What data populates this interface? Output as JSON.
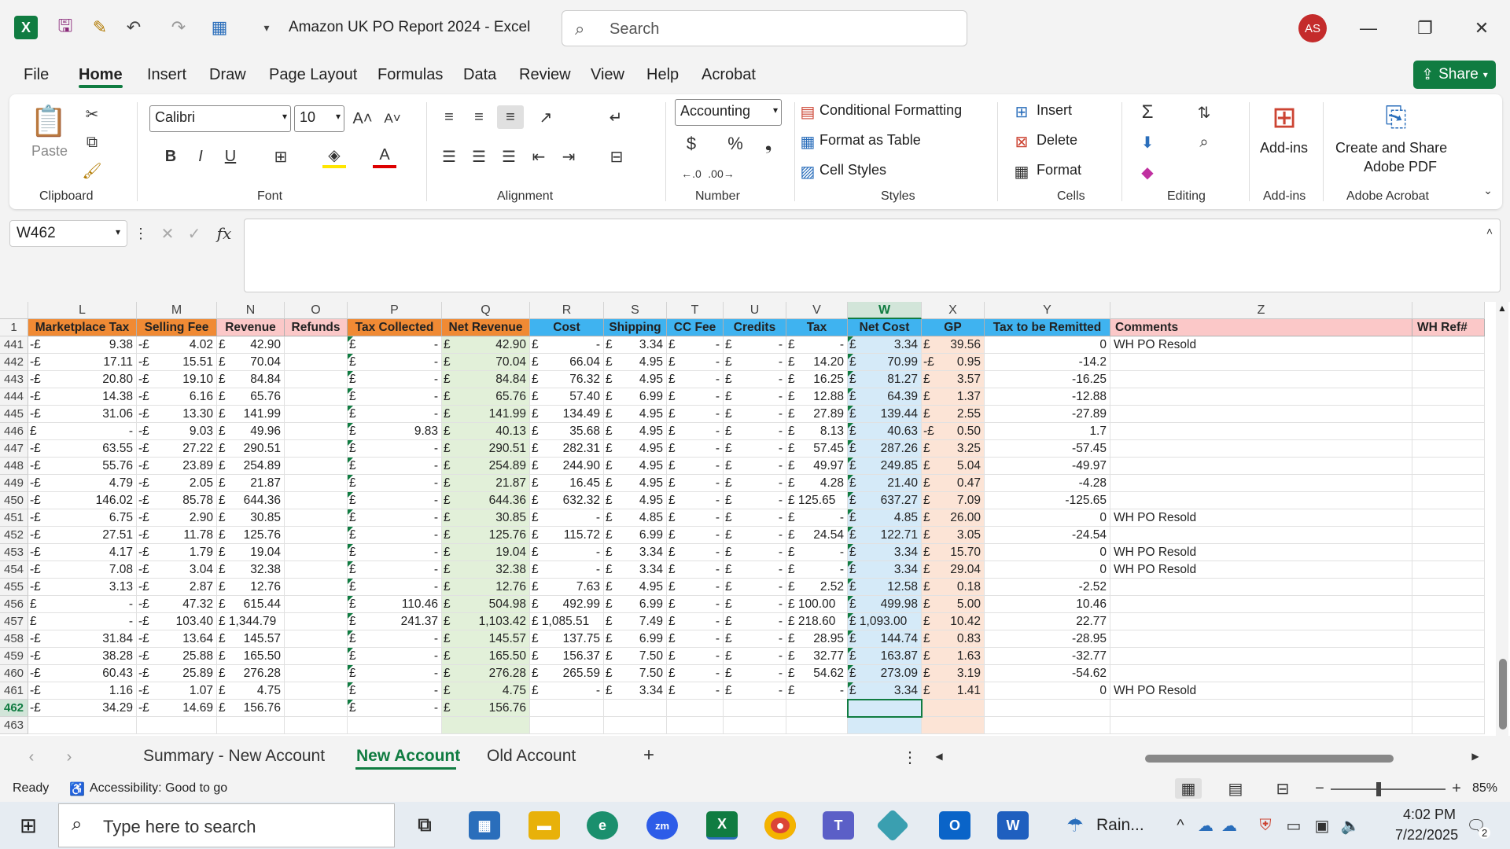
{
  "app": {
    "title": "Amazon UK PO Report 2024  -  Excel",
    "search_placeholder": "Search",
    "avatar": "AS"
  },
  "menu": [
    "File",
    "Home",
    "Insert",
    "Draw",
    "Page Layout",
    "Formulas",
    "Data",
    "Review",
    "View",
    "Help",
    "Acrobat"
  ],
  "share_label": "Share",
  "ribbon": {
    "clipboard": {
      "label": "Clipboard",
      "paste": "Paste"
    },
    "font": {
      "label": "Font",
      "name": "Calibri",
      "size": "10"
    },
    "alignment": {
      "label": "Alignment"
    },
    "number": {
      "label": "Number",
      "format": "Accounting"
    },
    "styles": {
      "label": "Styles",
      "cond": "Conditional Formatting",
      "table": "Format as Table",
      "cell": "Cell Styles"
    },
    "cells": {
      "label": "Cells",
      "insert": "Insert",
      "delete": "Delete",
      "format": "Format"
    },
    "editing": {
      "label": "Editing"
    },
    "addins": {
      "label": "Add-ins",
      "btn": "Add-ins"
    },
    "acrobat": {
      "label": "Adobe Acrobat",
      "btn1": "Create and Share",
      "btn2": "Adobe PDF"
    }
  },
  "namebox": "W462",
  "columns": [
    "L",
    "M",
    "N",
    "O",
    "P",
    "Q",
    "R",
    "S",
    "T",
    "U",
    "V",
    "W",
    "X",
    "Y",
    "Z"
  ],
  "headers": [
    "Marketplace Tax",
    "Selling Fee",
    "Revenue",
    "Refunds",
    "Tax Collected",
    "Net Revenue",
    "Cost",
    "Shipping",
    "CC Fee",
    "Credits",
    "Tax",
    "Net Cost",
    "GP",
    "Tax to be Remitted",
    "Comments",
    "WH Ref#"
  ],
  "rows": [
    [
      "441",
      "-£",
      "9.38",
      "-£",
      "4.02",
      "£",
      "42.90",
      "",
      "£",
      "-",
      "£",
      "42.90",
      "£",
      "-",
      "£",
      "3.34",
      "£",
      "-",
      "£",
      "-",
      "£",
      "-",
      "£",
      "3.34",
      "£",
      "39.56",
      "0",
      "WH PO Resold"
    ],
    [
      "442",
      "-£",
      "17.11",
      "-£",
      "15.51",
      "£",
      "70.04",
      "",
      "£",
      "-",
      "£",
      "70.04",
      "£",
      "66.04",
      "£",
      "4.95",
      "£",
      "-",
      "£",
      "-",
      "£",
      "14.20",
      "£",
      "70.99",
      "-£",
      "0.95",
      "-14.2",
      ""
    ],
    [
      "443",
      "-£",
      "20.80",
      "-£",
      "19.10",
      "£",
      "84.84",
      "",
      "£",
      "-",
      "£",
      "84.84",
      "£",
      "76.32",
      "£",
      "4.95",
      "£",
      "-",
      "£",
      "-",
      "£",
      "16.25",
      "£",
      "81.27",
      "£",
      "3.57",
      "-16.25",
      ""
    ],
    [
      "444",
      "-£",
      "14.38",
      "-£",
      "6.16",
      "£",
      "65.76",
      "",
      "£",
      "-",
      "£",
      "65.76",
      "£",
      "57.40",
      "£",
      "6.99",
      "£",
      "-",
      "£",
      "-",
      "£",
      "12.88",
      "£",
      "64.39",
      "£",
      "1.37",
      "-12.88",
      ""
    ],
    [
      "445",
      "-£",
      "31.06",
      "-£",
      "13.30",
      "£",
      "141.99",
      "",
      "£",
      "-",
      "£",
      "141.99",
      "£",
      "134.49",
      "£",
      "4.95",
      "£",
      "-",
      "£",
      "-",
      "£",
      "27.89",
      "£",
      "139.44",
      "£",
      "2.55",
      "-27.89",
      ""
    ],
    [
      "446",
      "£",
      "-",
      "-£",
      "9.03",
      "£",
      "49.96",
      "",
      "£",
      "9.83",
      "£",
      "40.13",
      "£",
      "35.68",
      "£",
      "4.95",
      "£",
      "-",
      "£",
      "-",
      "£",
      "8.13",
      "£",
      "40.63",
      "-£",
      "0.50",
      "1.7",
      ""
    ],
    [
      "447",
      "-£",
      "63.55",
      "-£",
      "27.22",
      "£",
      "290.51",
      "",
      "£",
      "-",
      "£",
      "290.51",
      "£",
      "282.31",
      "£",
      "4.95",
      "£",
      "-",
      "£",
      "-",
      "£",
      "57.45",
      "£",
      "287.26",
      "£",
      "3.25",
      "-57.45",
      ""
    ],
    [
      "448",
      "-£",
      "55.76",
      "-£",
      "23.89",
      "£",
      "254.89",
      "",
      "£",
      "-",
      "£",
      "254.89",
      "£",
      "244.90",
      "£",
      "4.95",
      "£",
      "-",
      "£",
      "-",
      "£",
      "49.97",
      "£",
      "249.85",
      "£",
      "5.04",
      "-49.97",
      ""
    ],
    [
      "449",
      "-£",
      "4.79",
      "-£",
      "2.05",
      "£",
      "21.87",
      "",
      "£",
      "-",
      "£",
      "21.87",
      "£",
      "16.45",
      "£",
      "4.95",
      "£",
      "-",
      "£",
      "-",
      "£",
      "4.28",
      "£",
      "21.40",
      "£",
      "0.47",
      "-4.28",
      ""
    ],
    [
      "450",
      "-£",
      "146.02",
      "-£",
      "85.78",
      "£",
      "644.36",
      "",
      "£",
      "-",
      "£",
      "644.36",
      "£",
      "632.32",
      "£",
      "4.95",
      "£",
      "-",
      "£",
      "-",
      "£ 125.65",
      "",
      "£",
      "637.27",
      "£",
      "7.09",
      "-125.65",
      ""
    ],
    [
      "451",
      "-£",
      "6.75",
      "-£",
      "2.90",
      "£",
      "30.85",
      "",
      "£",
      "-",
      "£",
      "30.85",
      "£",
      "-",
      "£",
      "4.85",
      "£",
      "-",
      "£",
      "-",
      "£",
      "-",
      "£",
      "4.85",
      "£",
      "26.00",
      "0",
      "WH PO Resold"
    ],
    [
      "452",
      "-£",
      "27.51",
      "-£",
      "11.78",
      "£",
      "125.76",
      "",
      "£",
      "-",
      "£",
      "125.76",
      "£",
      "115.72",
      "£",
      "6.99",
      "£",
      "-",
      "£",
      "-",
      "£",
      "24.54",
      "£",
      "122.71",
      "£",
      "3.05",
      "-24.54",
      ""
    ],
    [
      "453",
      "-£",
      "4.17",
      "-£",
      "1.79",
      "£",
      "19.04",
      "",
      "£",
      "-",
      "£",
      "19.04",
      "£",
      "-",
      "£",
      "3.34",
      "£",
      "-",
      "£",
      "-",
      "£",
      "-",
      "£",
      "3.34",
      "£",
      "15.70",
      "0",
      "WH PO Resold"
    ],
    [
      "454",
      "-£",
      "7.08",
      "-£",
      "3.04",
      "£",
      "32.38",
      "",
      "£",
      "-",
      "£",
      "32.38",
      "£",
      "-",
      "£",
      "3.34",
      "£",
      "-",
      "£",
      "-",
      "£",
      "-",
      "£",
      "3.34",
      "£",
      "29.04",
      "0",
      "WH PO Resold"
    ],
    [
      "455",
      "-£",
      "3.13",
      "-£",
      "2.87",
      "£",
      "12.76",
      "",
      "£",
      "-",
      "£",
      "12.76",
      "£",
      "7.63",
      "£",
      "4.95",
      "£",
      "-",
      "£",
      "-",
      "£",
      "2.52",
      "£",
      "12.58",
      "£",
      "0.18",
      "-2.52",
      ""
    ],
    [
      "456",
      "£",
      "-",
      "-£",
      "47.32",
      "£",
      "615.44",
      "",
      "£",
      "110.46",
      "£",
      "504.98",
      "£",
      "492.99",
      "£",
      "6.99",
      "£",
      "-",
      "£",
      "-",
      "£ 100.00",
      "",
      "£",
      "499.98",
      "£",
      "5.00",
      "10.46",
      ""
    ],
    [
      "457",
      "£",
      "-",
      "-£",
      "103.40",
      "£ 1,344.79",
      "",
      "",
      "£",
      "241.37",
      "£",
      "1,103.42",
      "£ 1,085.51",
      "",
      "£",
      "7.49",
      "£",
      "-",
      "£",
      "-",
      "£ 218.60",
      "",
      "£ 1,093.00",
      "",
      "£",
      "10.42",
      "22.77",
      ""
    ],
    [
      "458",
      "-£",
      "31.84",
      "-£",
      "13.64",
      "£",
      "145.57",
      "",
      "£",
      "-",
      "£",
      "145.57",
      "£",
      "137.75",
      "£",
      "6.99",
      "£",
      "-",
      "£",
      "-",
      "£",
      "28.95",
      "£",
      "144.74",
      "£",
      "0.83",
      "-28.95",
      ""
    ],
    [
      "459",
      "-£",
      "38.28",
      "-£",
      "25.88",
      "£",
      "165.50",
      "",
      "£",
      "-",
      "£",
      "165.50",
      "£",
      "156.37",
      "£",
      "7.50",
      "£",
      "-",
      "£",
      "-",
      "£",
      "32.77",
      "£",
      "163.87",
      "£",
      "1.63",
      "-32.77",
      ""
    ],
    [
      "460",
      "-£",
      "60.43",
      "-£",
      "25.89",
      "£",
      "276.28",
      "",
      "£",
      "-",
      "£",
      "276.28",
      "£",
      "265.59",
      "£",
      "7.50",
      "£",
      "-",
      "£",
      "-",
      "£",
      "54.62",
      "£",
      "273.09",
      "£",
      "3.19",
      "-54.62",
      ""
    ],
    [
      "461",
      "-£",
      "1.16",
      "-£",
      "1.07",
      "£",
      "4.75",
      "",
      "£",
      "-",
      "£",
      "4.75",
      "£",
      "-",
      "£",
      "3.34",
      "£",
      "-",
      "£",
      "-",
      "£",
      "-",
      "£",
      "3.34",
      "£",
      "1.41",
      "0",
      "WH PO Resold"
    ],
    [
      "462",
      "-£",
      "34.29",
      "-£",
      "14.69",
      "£",
      "156.76",
      "",
      "£",
      "-",
      "£",
      "156.76",
      "",
      "",
      "",
      "",
      "",
      "",
      "",
      "",
      "",
      "",
      "",
      "",
      "",
      "",
      "",
      ""
    ],
    [
      "463",
      "",
      "",
      "",
      "",
      "",
      "",
      "",
      "",
      "",
      "",
      "",
      "",
      "",
      "",
      "",
      "",
      "",
      "",
      "",
      "",
      "",
      "",
      "",
      "",
      "",
      "",
      ""
    ]
  ],
  "tabs": [
    "Summary - New Account",
    "New Account",
    "Old Account"
  ],
  "status": {
    "ready": "Ready",
    "accessibility": "Accessibility: Good to go",
    "zoom": "85%"
  },
  "taskbar": {
    "search": "Type here to search",
    "weather": "Rain...",
    "time": "4:02 PM",
    "date": "7/22/2025",
    "notif": "2"
  }
}
